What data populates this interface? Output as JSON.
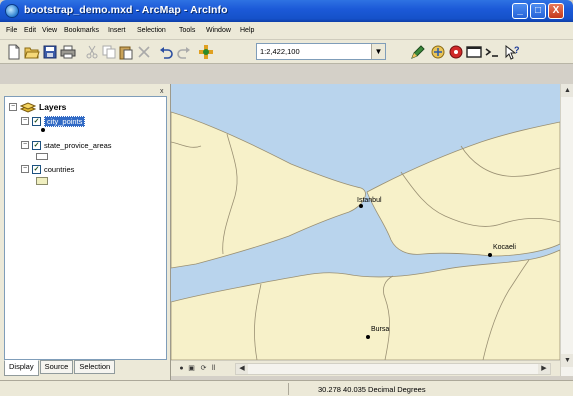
{
  "window": {
    "title": "bootstrap_demo.mxd - ArcMap - ArcInfo",
    "controls": {
      "minimize": "_",
      "maximize": "□",
      "close": "X"
    }
  },
  "menubar": {
    "items": [
      "File",
      "Edit",
      "View",
      "Bookmarks",
      "Insert",
      "Selection",
      "Tools",
      "Window",
      "Help"
    ]
  },
  "toolbar": {
    "scale_value": "1:2,422,100",
    "icons": [
      "new-document-icon",
      "open-folder-icon",
      "save-icon",
      "print-icon",
      "cut-icon",
      "copy-icon",
      "paste-icon",
      "delete-icon",
      "undo-icon",
      "redo-icon",
      "add-data-icon",
      "editor-icon",
      "arctoolbox-icon",
      "arccatalog-icon",
      "command-line-icon",
      "python-icon",
      "whats-this-icon"
    ]
  },
  "toc": {
    "close_label": "x",
    "root": {
      "label": "Layers"
    },
    "layers": [
      {
        "label": "city_points",
        "selected": true,
        "checked": true,
        "symbol": "point"
      },
      {
        "label": "state_provice_areas",
        "selected": false,
        "checked": true,
        "symbol": "polygon-empty"
      },
      {
        "label": "countries",
        "selected": false,
        "checked": true,
        "symbol": "polygon-yellow"
      }
    ],
    "tabs": [
      "Display",
      "Source",
      "Selection"
    ],
    "active_tab": "Display"
  },
  "map": {
    "colors": {
      "water": "#b9d4ed",
      "land": "#f7f1c9",
      "border": "#9a9073",
      "city": "#000000"
    },
    "cities": [
      "Istanbul",
      "Kocaeli",
      "Bursa"
    ]
  },
  "statusbar": {
    "coordinates": "30.278  40.035 Decimal Degrees"
  }
}
